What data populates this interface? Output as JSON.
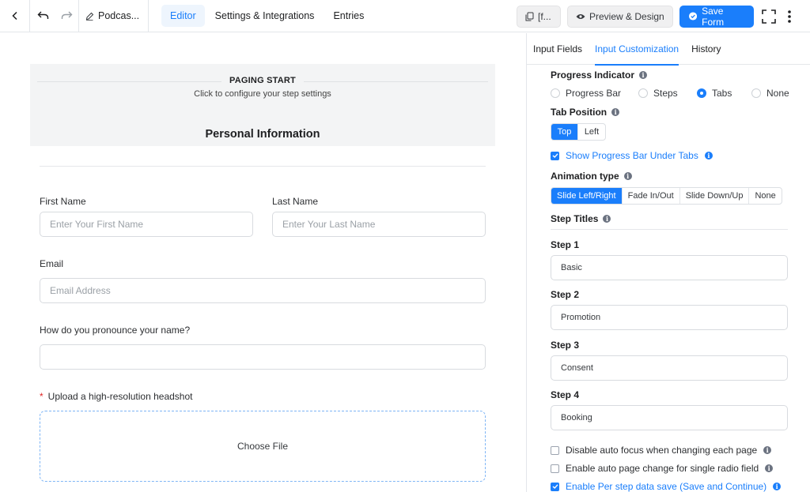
{
  "topbar": {
    "form_title": "Podcas...",
    "tabs": [
      {
        "label": "Editor",
        "active": true
      },
      {
        "label": "Settings & Integrations",
        "active": false
      },
      {
        "label": "Entries",
        "active": false
      }
    ],
    "shortcode_label": "[f...",
    "preview_label": "Preview & Design",
    "save_label": "Save Form"
  },
  "canvas": {
    "paging_title": "PAGING START",
    "paging_sub": "Click to configure your step settings",
    "section_title": "Personal Information",
    "first_name_label": "First Name",
    "first_name_placeholder": "Enter Your First Name",
    "last_name_label": "Last Name",
    "last_name_placeholder": "Enter Your Last Name",
    "email_label": "Email",
    "email_placeholder": "Email Address",
    "pronounce_label": "How do you pronounce your name?",
    "pronounce_placeholder": "",
    "upload_required_mark": "*",
    "upload_label": "Upload a high-resolution headshot",
    "upload_button": "Choose File"
  },
  "panel": {
    "tabs": [
      {
        "label": "Input Fields",
        "active": false
      },
      {
        "label": "Input Customization",
        "active": true
      },
      {
        "label": "History",
        "active": false
      }
    ],
    "progress_indicator_label": "Progress Indicator",
    "progress_options": [
      {
        "label": "Progress Bar",
        "selected": false
      },
      {
        "label": "Steps",
        "selected": false
      },
      {
        "label": "Tabs",
        "selected": true
      },
      {
        "label": "None",
        "selected": false
      }
    ],
    "tab_position_label": "Tab Position",
    "tab_position_options": [
      {
        "label": "Top",
        "selected": true
      },
      {
        "label": "Left",
        "selected": false
      }
    ],
    "show_progress_label": "Show Progress Bar Under Tabs",
    "show_progress_checked": true,
    "animation_label": "Animation type",
    "animation_options": [
      {
        "label": "Slide Left/Right",
        "selected": true
      },
      {
        "label": "Fade In/Out",
        "selected": false
      },
      {
        "label": "Slide Down/Up",
        "selected": false
      },
      {
        "label": "None",
        "selected": false
      }
    ],
    "step_titles_label": "Step Titles",
    "steps": [
      {
        "label": "Step 1",
        "value": "Basic"
      },
      {
        "label": "Step 2",
        "value": "Promotion"
      },
      {
        "label": "Step 3",
        "value": "Consent"
      },
      {
        "label": "Step 4",
        "value": "Booking"
      }
    ],
    "checkboxes": [
      {
        "label": "Disable auto focus when changing each page",
        "checked": false
      },
      {
        "label": "Enable auto page change for single radio field",
        "checked": false
      },
      {
        "label": "Enable Per step data save (Save and Continue)",
        "checked": true
      }
    ]
  },
  "colors": {
    "accent": "#1a7efb",
    "required": "#e02424",
    "border": "#d8dbdf"
  },
  "icons": [
    "chevron-left-icon",
    "undo-icon",
    "redo-icon",
    "pencil-icon",
    "copy-icon",
    "eye-icon",
    "check-circle-icon",
    "fullscreen-icon",
    "more-vertical-icon",
    "info-icon",
    "checkbox-check-icon"
  ]
}
